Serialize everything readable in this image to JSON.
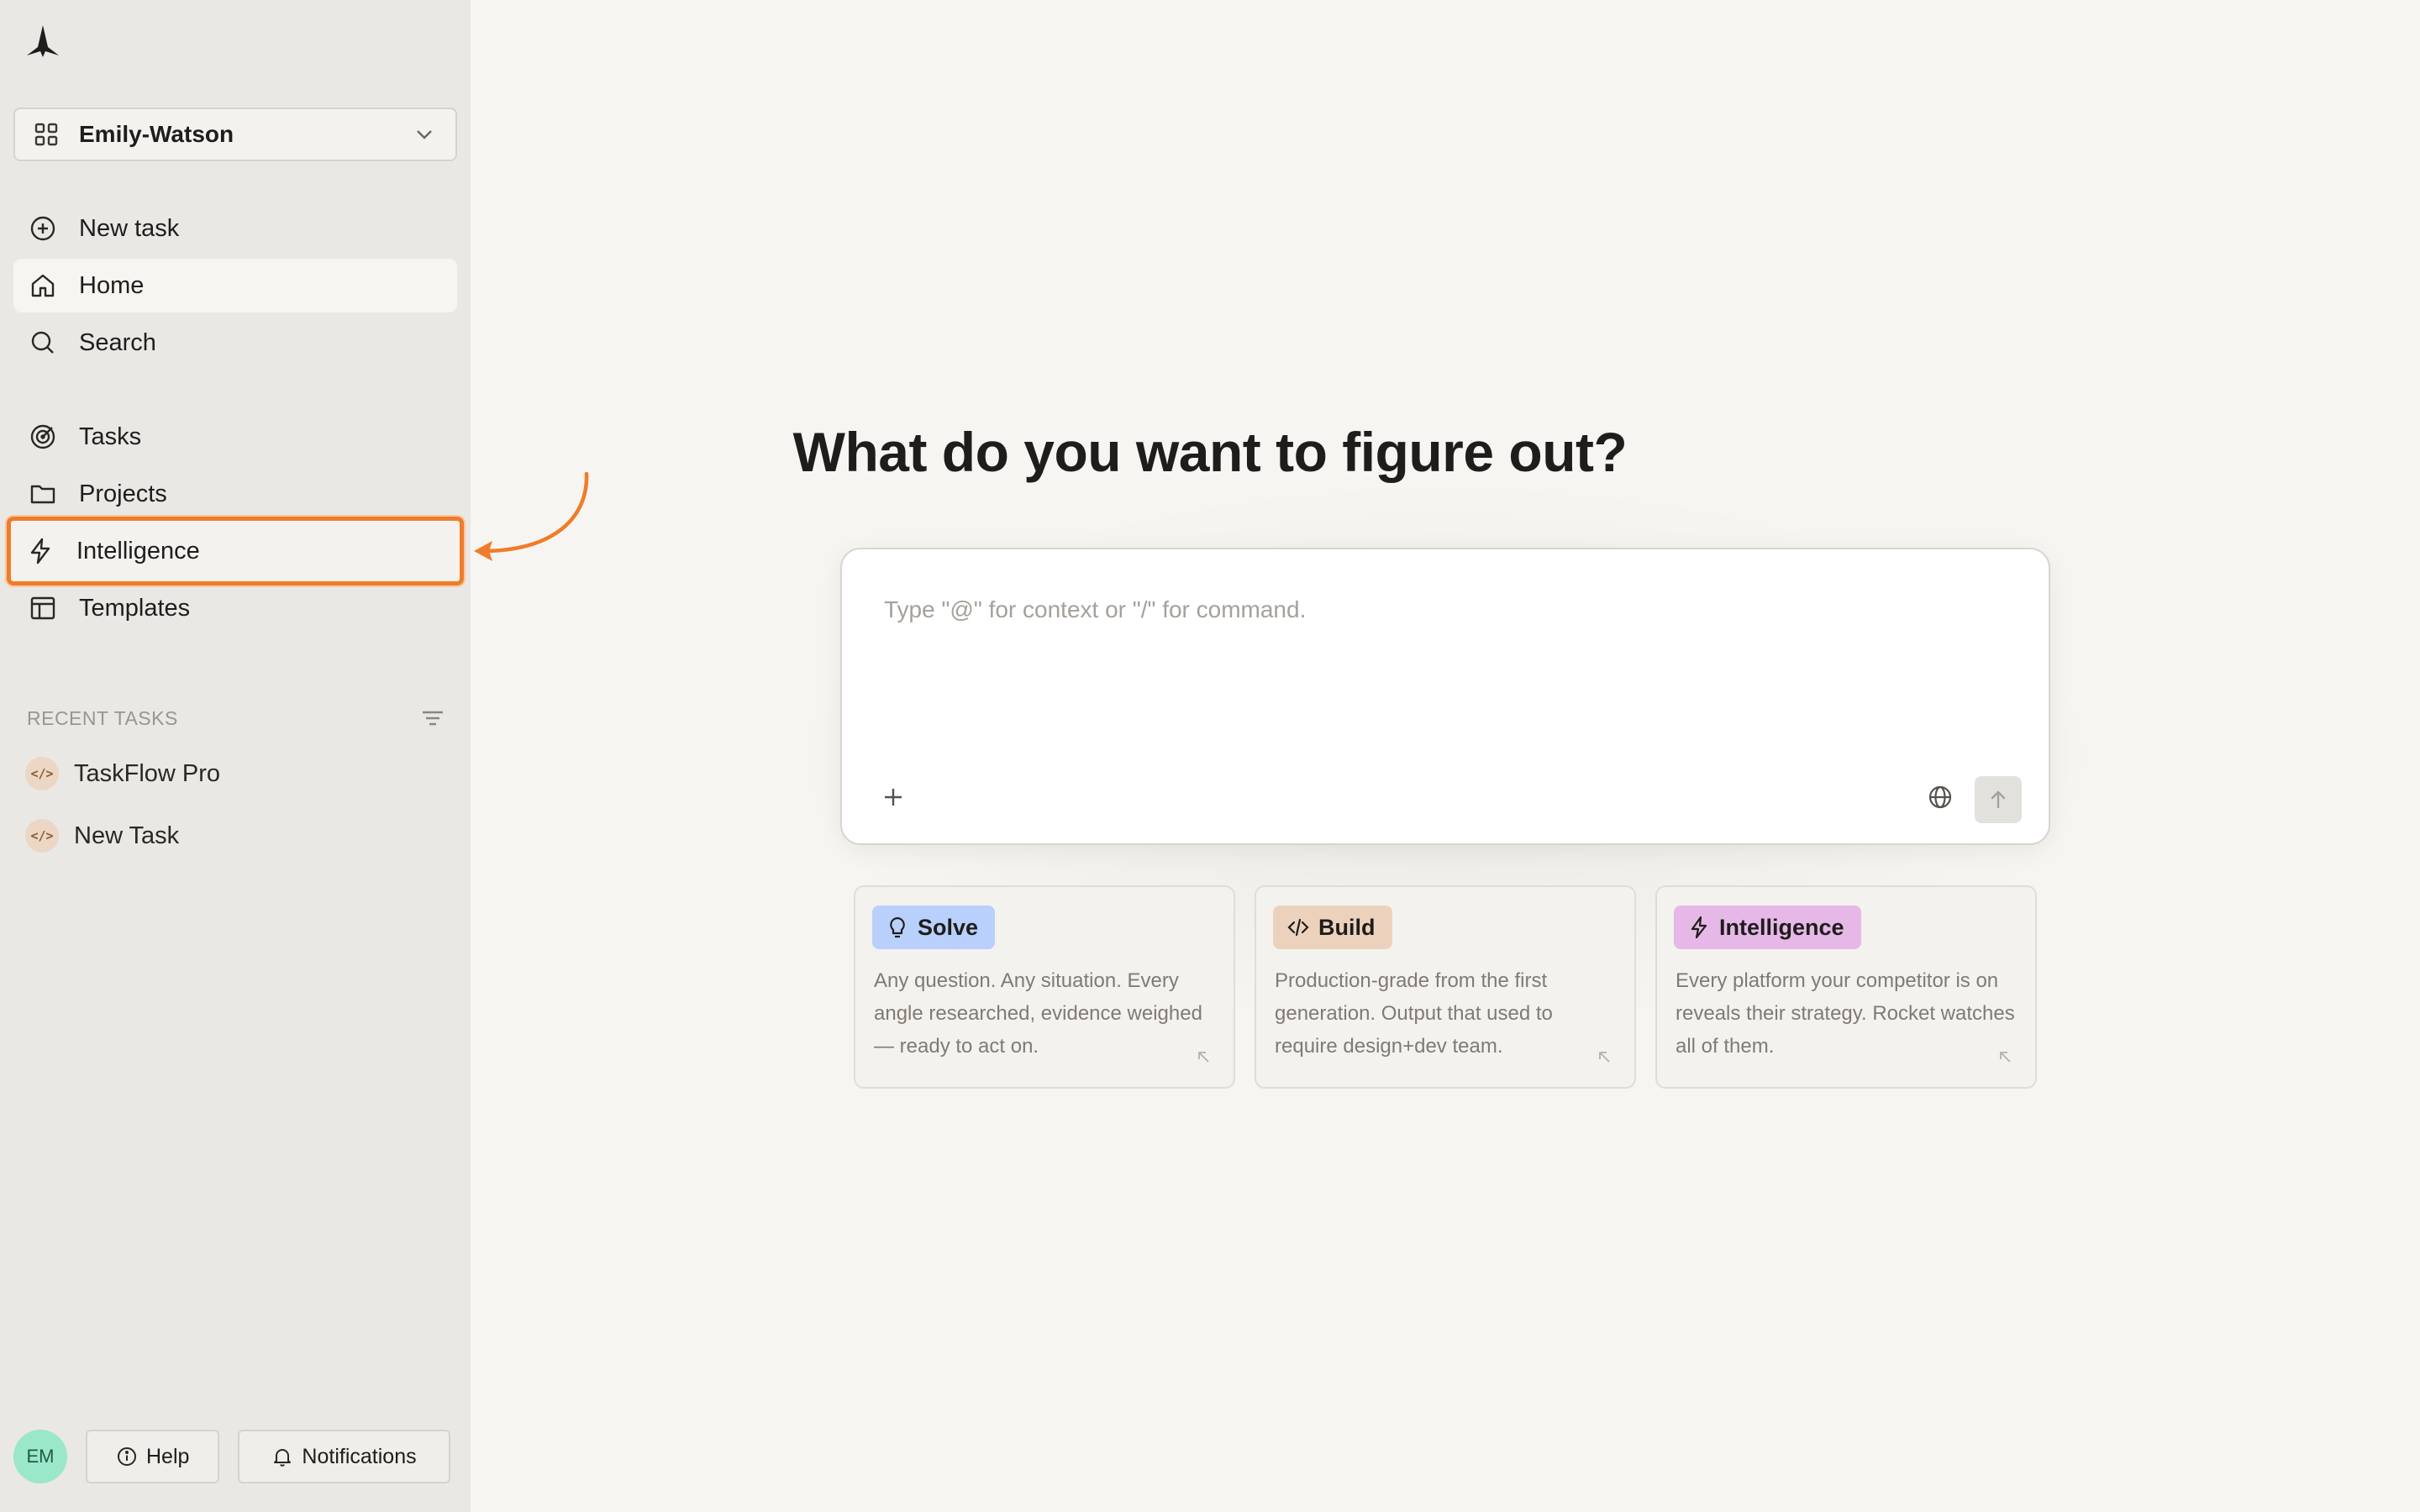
{
  "workspace": {
    "name": "Emily-Watson"
  },
  "nav": {
    "new_task": "New task",
    "home": "Home",
    "search": "Search",
    "tasks": "Tasks",
    "projects": "Projects",
    "intelligence": "Intelligence",
    "templates": "Templates"
  },
  "recent": {
    "title": "RECENT TASKS",
    "items": [
      {
        "label": "TaskFlow Pro",
        "badge": "</>"
      },
      {
        "label": "New Task",
        "badge": "</>"
      }
    ]
  },
  "footer": {
    "avatar": "EM",
    "help": "Help",
    "notifications": "Notifications"
  },
  "main": {
    "headline": "What do you want to figure out?",
    "composer_placeholder": "Type \"@\" for context or \"/\" for command."
  },
  "cards": [
    {
      "tag": "Solve",
      "color": "#b8d0fb",
      "desc": "Any question. Any situation. Every angle researched, evidence weighed — ready to act on."
    },
    {
      "tag": "Build",
      "color": "#ecd2bd",
      "desc": "Production-grade from the first generation. Output that used to require design+dev team."
    },
    {
      "tag": "Intelligence",
      "color": "#e6b8e8",
      "desc": "Every platform your competitor is on reveals their strategy. Rocket watches all of them."
    }
  ],
  "colors": {
    "accent_highlight": "#f07c2a",
    "sidebar_bg": "#eae8e4",
    "page_bg": "#f7f5f1"
  }
}
